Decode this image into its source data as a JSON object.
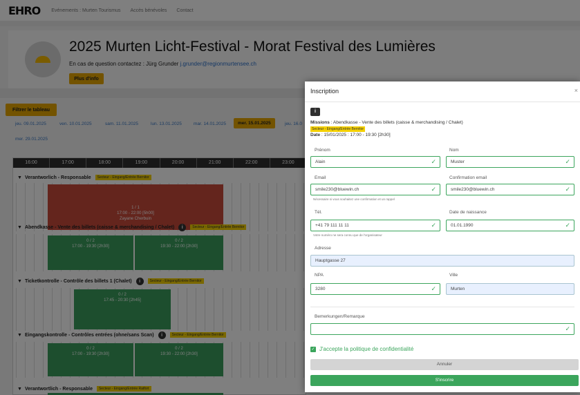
{
  "nav": {
    "logo": "EHRO",
    "links": [
      "Evénements : Murten Tourismus",
      "Accès bénévoles",
      "Contact"
    ]
  },
  "event": {
    "title": "2025 Murten Licht-Festival - Morat Festival des Lumières",
    "contact_prefix": "En cas de question contactez : Jürg Grunder",
    "contact_email": "j.grunder@regionmurtensee.ch",
    "more_label": "Plus d'info"
  },
  "filter_label": "Filtrer le tableau",
  "date_tabs": [
    {
      "label": "jeu. 09.01.2025",
      "active": false
    },
    {
      "label": "ven. 10.01.2025",
      "active": false
    },
    {
      "label": "sam. 11.01.2025",
      "active": false
    },
    {
      "label": "lun. 13.01.2025",
      "active": false
    },
    {
      "label": "mar. 14.01.2025",
      "active": false
    },
    {
      "label": "mer. 15.01.2025",
      "active": true
    },
    {
      "label": "jeu. 16.0",
      "active": false
    },
    {
      "label": "mer. 29.01.2025",
      "active": false
    }
  ],
  "schedule": {
    "hours": [
      "16:00",
      "17:00",
      "18:00",
      "19:00",
      "20:00",
      "21:00",
      "22:00",
      "23:00"
    ],
    "rows": [
      {
        "title": "Verantworlich - Responsable",
        "sector": "Secteur - Eingang/Entrée Bernitor",
        "slots": [
          {
            "count": "1 / 1",
            "time": "17:00 - 22:00 [5h00]",
            "person": "Zayane Cherbuin",
            "color": "red"
          }
        ]
      },
      {
        "title": "Abendkasse - Vente des billets (caisse & merchandising / Chalet)",
        "sector": "Secteur - Eingang/Entrée Bernitor",
        "slots": [
          {
            "count": "0 / 2",
            "time": "17:00 - 19:30 [2h30]",
            "color": "green"
          },
          {
            "count": "0 / 2",
            "time": "19:30 - 22:00 [2h30]",
            "color": "green"
          }
        ]
      },
      {
        "title": "Ticketkontrolle - Contrôle des billets 1 (Chalet)",
        "sector": "Secteur - Eingang/Entrée Bernitor",
        "slots": [
          {
            "count": "0 / 2",
            "time": "17:45 - 20:30 [2h45]",
            "color": "green"
          }
        ]
      },
      {
        "title": "Eingangskontrolle - Contrôles entrées (ohne/sans Scan)",
        "sector": "Secteur - Eingang/Entrée Bernitor",
        "slots": [
          {
            "count": "0 / 2",
            "time": "17:00 - 19:30 [2h30]",
            "color": "green"
          },
          {
            "count": "0 / 2",
            "time": "19:30 - 22:00 [2h30]",
            "color": "green"
          }
        ]
      },
      {
        "title": "Verantwortlich - Responsable",
        "sector": "Secteur - Eingang/Entrée Ratfort",
        "slots": []
      }
    ]
  },
  "modal": {
    "title": "Inscription",
    "close": "×",
    "info": "i",
    "missions_label": "Missions",
    "missions_value": " : Abendkasse - Vente des billets (caisse & merchandising / Chalet)",
    "sector": "Secteur - Eingang/Entrée Bernitor",
    "date_label": "Date",
    "date_value": " : 15/01/2025 : 17:00 - 19:30 [2h30]",
    "fields": {
      "prenom": {
        "label": "Prénom",
        "value": "Alain"
      },
      "nom": {
        "label": "Nom",
        "value": "Muster"
      },
      "email": {
        "label": "Email",
        "value": "smile230@bluewin.ch",
        "hint": "Nécessaire si vous souhaitez une confirmation et un rappel"
      },
      "email_confirm": {
        "label": "Confirmation email",
        "value": "smile230@bluewin.ch"
      },
      "tel": {
        "label": "Tél.",
        "value": "+41 79 111 11 11",
        "hint": "Votre numéro ne sera connu que de l'organisateur"
      },
      "birth": {
        "label": "Date de naissance",
        "value": "01.01.1990"
      },
      "address": {
        "label": "Adresse",
        "value": "Hauptgasse 27"
      },
      "npa": {
        "label": "NPA",
        "value": "3280"
      },
      "ville": {
        "label": "Ville",
        "value": "Murten"
      },
      "remark": {
        "label": "Bemerkungen/Remarque",
        "value": ""
      }
    },
    "privacy_label": "J'accepte la politique de confidentialité",
    "cancel_label": "Annuler",
    "submit_label": "S'inscrire"
  }
}
